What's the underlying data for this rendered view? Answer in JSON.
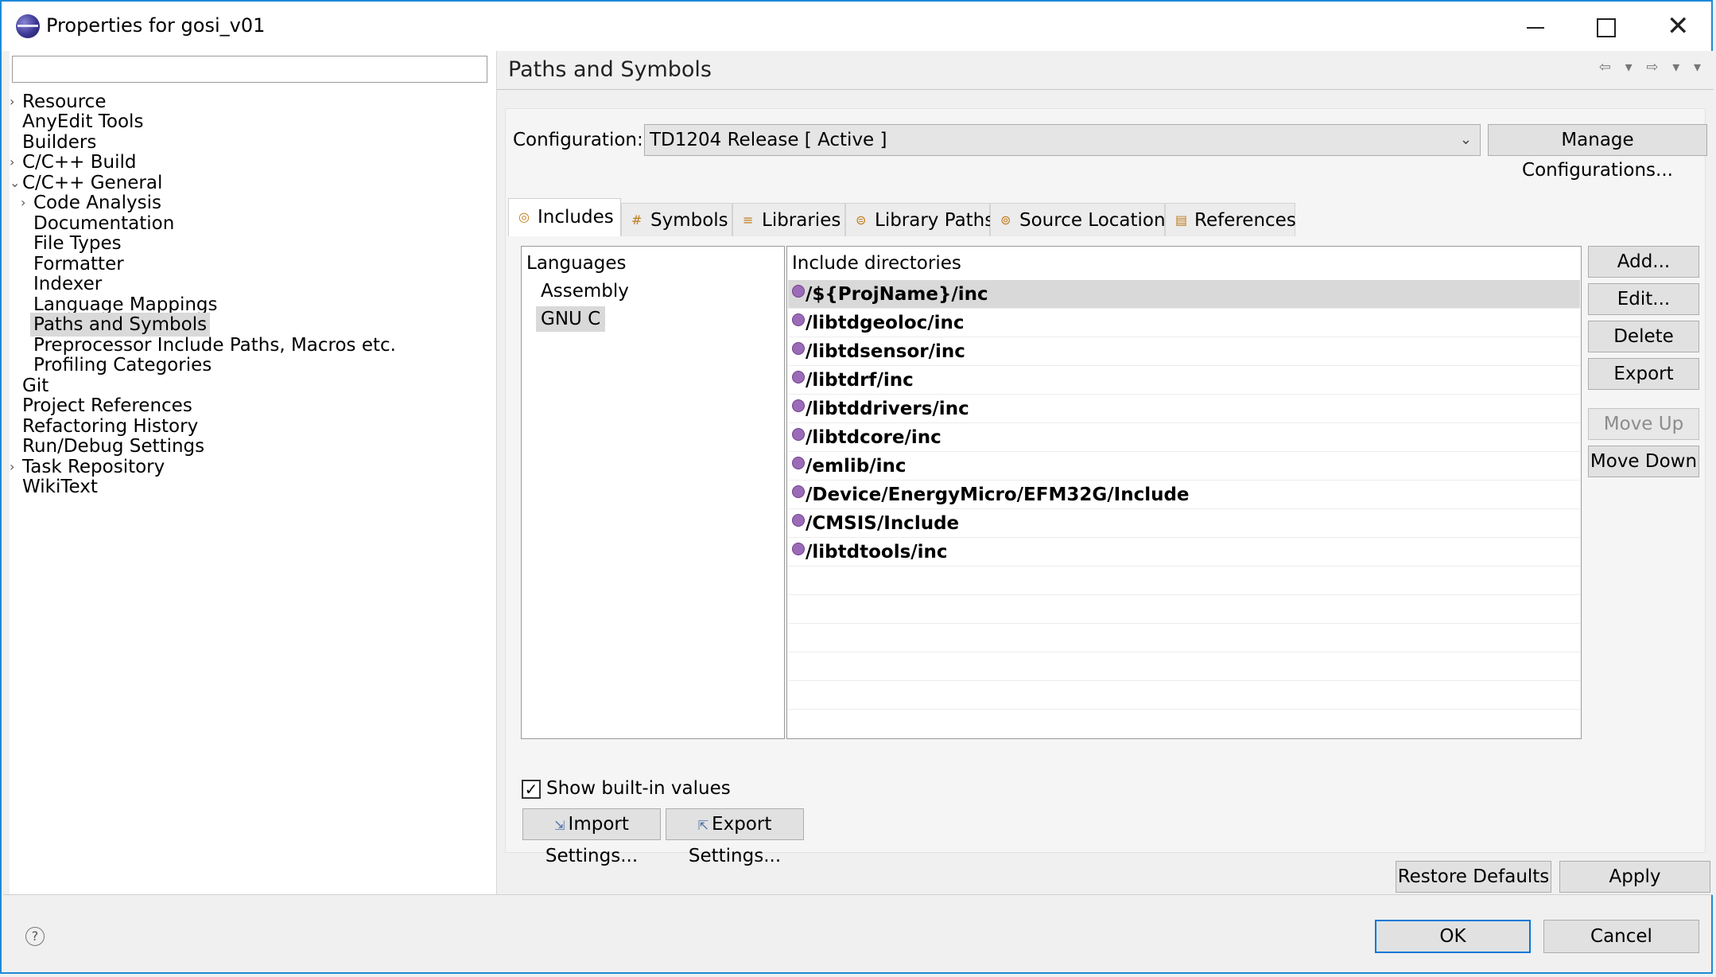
{
  "window": {
    "title": "Properties for gosi_v01"
  },
  "filter": {
    "placeholder": ""
  },
  "tree": [
    {
      "label": "Resource",
      "expander": "›"
    },
    {
      "label": "AnyEdit Tools",
      "expander": ""
    },
    {
      "label": "Builders",
      "expander": ""
    },
    {
      "label": "C/C++ Build",
      "expander": "›"
    },
    {
      "label": "C/C++ General",
      "expander": "⌄"
    },
    {
      "label": "Code Analysis",
      "expander": "›"
    },
    {
      "label": "Documentation",
      "expander": ""
    },
    {
      "label": "File Types",
      "expander": ""
    },
    {
      "label": "Formatter",
      "expander": ""
    },
    {
      "label": "Indexer",
      "expander": ""
    },
    {
      "label": "Language Mappings",
      "expander": ""
    },
    {
      "label": "Paths and Symbols",
      "expander": ""
    },
    {
      "label": "Preprocessor Include Paths, Macros etc.",
      "expander": ""
    },
    {
      "label": "Profiling Categories",
      "expander": ""
    },
    {
      "label": "Git",
      "expander": ""
    },
    {
      "label": "Project References",
      "expander": ""
    },
    {
      "label": "Refactoring History",
      "expander": ""
    },
    {
      "label": "Run/Debug Settings",
      "expander": ""
    },
    {
      "label": "Task Repository",
      "expander": "›"
    },
    {
      "label": "WikiText",
      "expander": ""
    }
  ],
  "page": {
    "title": "Paths and Symbols"
  },
  "configuration": {
    "label": "Configuration:",
    "value": "TD1204 Release  [ Active ]",
    "manage_label": "Manage Configurations..."
  },
  "tabs": [
    {
      "label": "Includes",
      "icon": "includes-icon"
    },
    {
      "label": "Symbols",
      "icon": "symbols-icon"
    },
    {
      "label": "Libraries",
      "icon": "libraries-icon"
    },
    {
      "label": "Library Paths",
      "icon": "library-paths-icon"
    },
    {
      "label": "Source Location",
      "icon": "source-location-icon"
    },
    {
      "label": "References",
      "icon": "references-icon"
    }
  ],
  "languages": {
    "header": "Languages",
    "items": [
      "Assembly",
      "GNU C"
    ]
  },
  "includes": {
    "header": "Include directories",
    "items": [
      "/${ProjName}/inc",
      "/libtdgeoloc/inc",
      "/libtdsensor/inc",
      "/libtdrf/inc",
      "/libtddrivers/inc",
      "/libtdcore/inc",
      "/emlib/inc",
      "/Device/EnergyMicro/EFM32G/Include",
      "/CMSIS/Include",
      "/libtdtools/inc"
    ]
  },
  "side_buttons": {
    "add": "Add...",
    "edit": "Edit...",
    "delete": "Delete",
    "export": "Export",
    "move_up": "Move Up",
    "move_down": "Move Down"
  },
  "show_builtin": {
    "label": "Show built-in values",
    "checked_glyph": "✓"
  },
  "settings_buttons": {
    "import": "Import Settings...",
    "export": "Export Settings..."
  },
  "page_buttons": {
    "restore": "Restore Defaults",
    "apply": "Apply"
  },
  "dialog_buttons": {
    "ok": "OK",
    "cancel": "Cancel",
    "help_glyph": "?"
  },
  "window_controls": {
    "close_glyph": "✕"
  },
  "tab_glyphs": [
    "◎",
    "#",
    "≡",
    "⊜",
    "⊚",
    "▤"
  ],
  "nav_glyphs": "⇦ ▾ ⇨ ▾ ▾"
}
